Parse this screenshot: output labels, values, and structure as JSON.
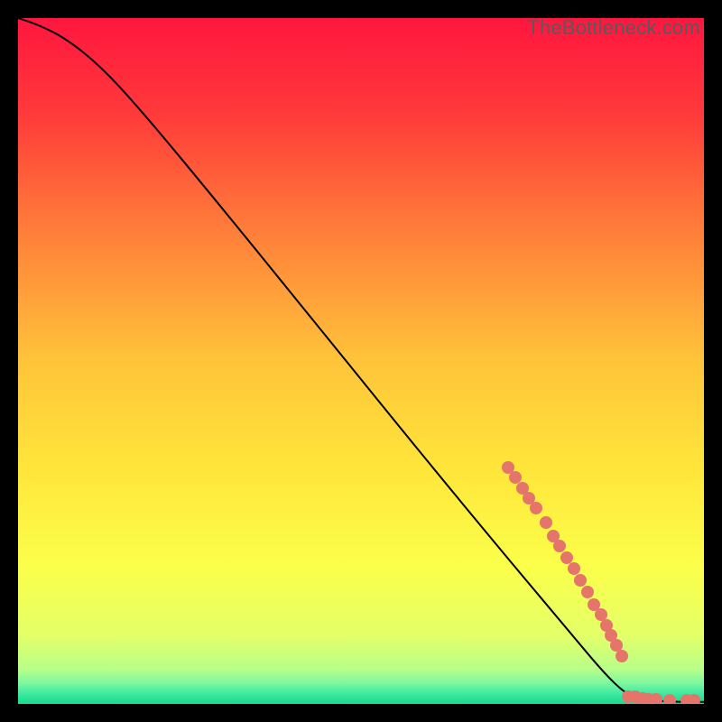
{
  "watermark": "TheBottleneck.com",
  "colors": {
    "frame": "#000000",
    "grad_top": "#ff1a3e",
    "grad_mid1": "#ff7a3a",
    "grad_mid2": "#ffe13a",
    "grad_mid3": "#f6ff57",
    "grad_mid4": "#c9ff7a",
    "grad_bottom": "#1fe28a",
    "curve": "#000000",
    "dot": "#e5756b"
  },
  "chart_data": {
    "type": "line",
    "title": "",
    "xlabel": "",
    "ylabel": "",
    "xlim": [
      0,
      100
    ],
    "ylim": [
      0,
      100
    ],
    "legend": false,
    "grid": false,
    "annotations": [
      "TheBottleneck.com"
    ],
    "curve": [
      {
        "x": 0,
        "y": 100
      },
      {
        "x": 3,
        "y": 99
      },
      {
        "x": 7,
        "y": 97
      },
      {
        "x": 12,
        "y": 93
      },
      {
        "x": 18,
        "y": 86.5
      },
      {
        "x": 30,
        "y": 72
      },
      {
        "x": 45,
        "y": 53.5
      },
      {
        "x": 60,
        "y": 35
      },
      {
        "x": 72,
        "y": 20.5
      },
      {
        "x": 80,
        "y": 11
      },
      {
        "x": 85,
        "y": 5
      },
      {
        "x": 88,
        "y": 2
      },
      {
        "x": 90,
        "y": 0.8
      },
      {
        "x": 95,
        "y": 0.3
      },
      {
        "x": 100,
        "y": 0.3
      }
    ],
    "series": [
      {
        "name": "markers",
        "points": [
          {
            "x": 71.5,
            "y": 34.5
          },
          {
            "x": 72.5,
            "y": 33.0
          },
          {
            "x": 73.5,
            "y": 31.5
          },
          {
            "x": 74.5,
            "y": 30.0
          },
          {
            "x": 75.5,
            "y": 28.5
          },
          {
            "x": 77.0,
            "y": 26.5
          },
          {
            "x": 78.0,
            "y": 24.5
          },
          {
            "x": 79.0,
            "y": 23.0
          },
          {
            "x": 80.0,
            "y": 21.3
          },
          {
            "x": 81.0,
            "y": 19.7
          },
          {
            "x": 82.0,
            "y": 18.0
          },
          {
            "x": 83.0,
            "y": 16.3
          },
          {
            "x": 84.0,
            "y": 14.5
          },
          {
            "x": 85.0,
            "y": 13.0
          },
          {
            "x": 85.8,
            "y": 11.5
          },
          {
            "x": 86.5,
            "y": 10.0
          },
          {
            "x": 87.3,
            "y": 8.5
          },
          {
            "x": 88.0,
            "y": 7.0
          },
          {
            "x": 89.0,
            "y": 1.0
          },
          {
            "x": 90.0,
            "y": 1.0
          },
          {
            "x": 91.0,
            "y": 0.8
          },
          {
            "x": 92.0,
            "y": 0.7
          },
          {
            "x": 93.0,
            "y": 0.6
          },
          {
            "x": 95.0,
            "y": 0.5
          },
          {
            "x": 97.5,
            "y": 0.5
          },
          {
            "x": 98.5,
            "y": 0.5
          }
        ]
      }
    ]
  }
}
